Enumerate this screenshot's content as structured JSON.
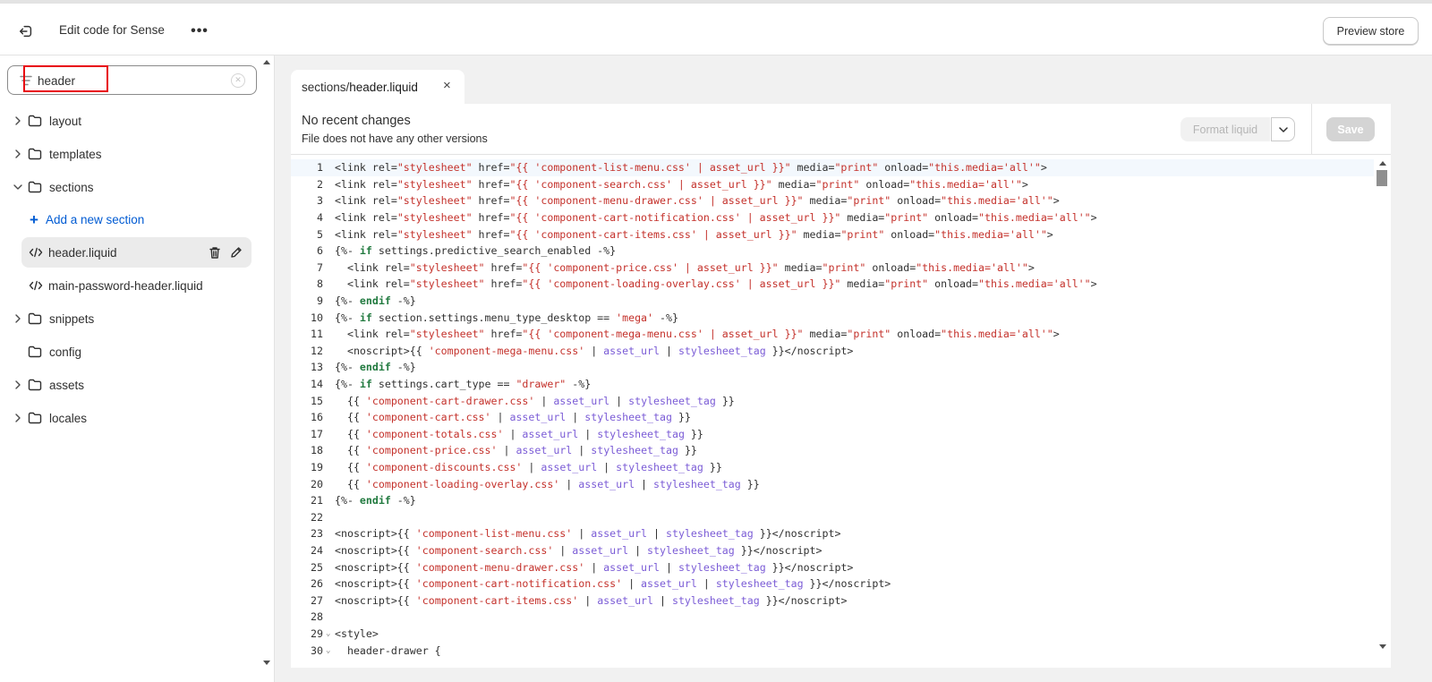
{
  "topbar": {
    "exit_icon": "exit-icon",
    "title": "Edit code for Sense",
    "more_icon": "more-horizontal-icon",
    "more_label": "•••",
    "preview_label": "Preview store"
  },
  "sidebar": {
    "search": {
      "value": "header",
      "placeholder": ""
    },
    "tree": [
      {
        "label": "layout",
        "expanded": false,
        "has_children": true
      },
      {
        "label": "templates",
        "expanded": false,
        "has_children": true
      },
      {
        "label": "sections",
        "expanded": true,
        "has_children": true
      },
      {
        "label": "snippets",
        "expanded": false,
        "has_children": true
      },
      {
        "label": "config",
        "expanded": false,
        "has_children": false
      },
      {
        "label": "assets",
        "expanded": false,
        "has_children": true
      },
      {
        "label": "locales",
        "expanded": false,
        "has_children": true
      }
    ],
    "add_section_label": "Add a new section",
    "files": [
      {
        "label": "header.liquid",
        "active": true
      },
      {
        "label": "main-password-header.liquid",
        "active": false
      }
    ]
  },
  "tab": {
    "prefix": "sections/",
    "name": "header.liquid",
    "close_label": "×"
  },
  "editor": {
    "title": "No recent changes",
    "subtitle": "File does not have any other versions",
    "format_label": "Format liquid",
    "save_label": "Save",
    "lines": [
      "<link rel=\"stylesheet\" href=\"{{ 'component-list-menu.css' | asset_url }}\" media=\"print\" onload=\"this.media='all'\">",
      "<link rel=\"stylesheet\" href=\"{{ 'component-search.css' | asset_url }}\" media=\"print\" onload=\"this.media='all'\">",
      "<link rel=\"stylesheet\" href=\"{{ 'component-menu-drawer.css' | asset_url }}\" media=\"print\" onload=\"this.media='all'\">",
      "<link rel=\"stylesheet\" href=\"{{ 'component-cart-notification.css' | asset_url }}\" media=\"print\" onload=\"this.media='all'\">",
      "<link rel=\"stylesheet\" href=\"{{ 'component-cart-items.css' | asset_url }}\" media=\"print\" onload=\"this.media='all'\">",
      "{%- if settings.predictive_search_enabled -%}",
      "  <link rel=\"stylesheet\" href=\"{{ 'component-price.css' | asset_url }}\" media=\"print\" onload=\"this.media='all'\">",
      "  <link rel=\"stylesheet\" href=\"{{ 'component-loading-overlay.css' | asset_url }}\" media=\"print\" onload=\"this.media='all'\">",
      "{%- endif -%}",
      "{%- if section.settings.menu_type_desktop == 'mega' -%}",
      "  <link rel=\"stylesheet\" href=\"{{ 'component-mega-menu.css' | asset_url }}\" media=\"print\" onload=\"this.media='all'\">",
      "  <noscript>{{ 'component-mega-menu.css' | asset_url | stylesheet_tag }}</noscript>",
      "{%- endif -%}",
      "{%- if settings.cart_type == \"drawer\" -%}",
      "  {{ 'component-cart-drawer.css' | asset_url | stylesheet_tag }}",
      "  {{ 'component-cart.css' | asset_url | stylesheet_tag }}",
      "  {{ 'component-totals.css' | asset_url | stylesheet_tag }}",
      "  {{ 'component-price.css' | asset_url | stylesheet_tag }}",
      "  {{ 'component-discounts.css' | asset_url | stylesheet_tag }}",
      "  {{ 'component-loading-overlay.css' | asset_url | stylesheet_tag }}",
      "{%- endif -%}",
      "",
      "<noscript>{{ 'component-list-menu.css' | asset_url | stylesheet_tag }}</noscript>",
      "<noscript>{{ 'component-search.css' | asset_url | stylesheet_tag }}</noscript>",
      "<noscript>{{ 'component-menu-drawer.css' | asset_url | stylesheet_tag }}</noscript>",
      "<noscript>{{ 'component-cart-notification.css' | asset_url | stylesheet_tag }}</noscript>",
      "<noscript>{{ 'component-cart-items.css' | asset_url | stylesheet_tag }}</noscript>",
      "",
      "<style>",
      "  header-drawer {"
    ],
    "fold_lines": [
      29,
      30
    ],
    "current_line": 1
  },
  "colors": {
    "accent": "#005bd3",
    "string": "#c4312b",
    "filter": "#7b5cd6",
    "keyword": "#217a3f",
    "highlight": "#e8000b"
  }
}
